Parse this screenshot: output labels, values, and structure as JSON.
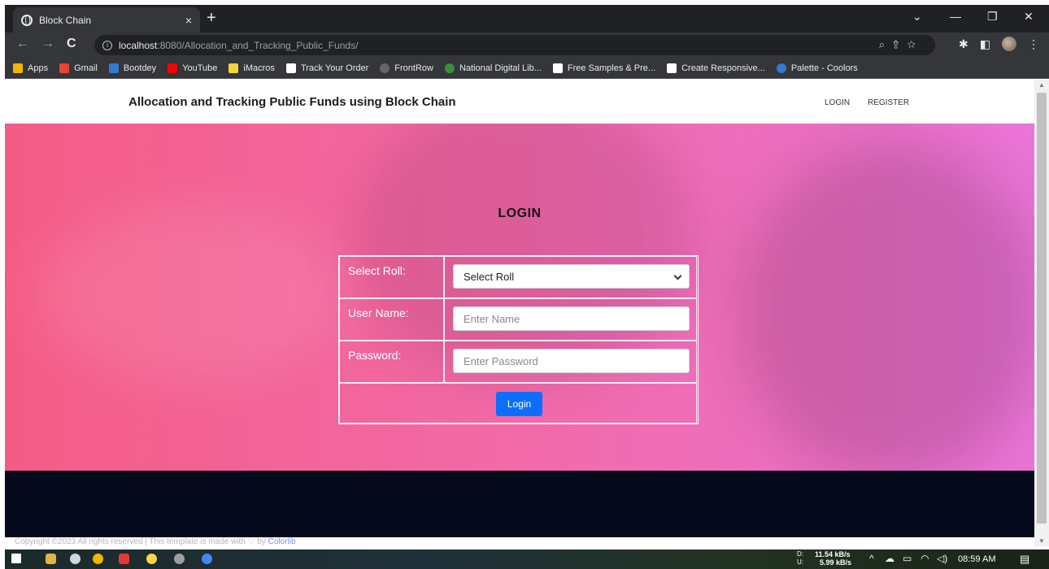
{
  "browser": {
    "tab_title": "Block Chain",
    "tab_close": "×",
    "new_tab": "+",
    "url_host": "localhost",
    "url_path": ":8080/Allocation_and_Tracking_Public_Funds/",
    "bookmarks": [
      {
        "label": "Apps",
        "color": "#f4b400"
      },
      {
        "label": "Gmail",
        "color": "#ea4335"
      },
      {
        "label": "Bootdey",
        "color": "#2f7bd6"
      },
      {
        "label": "YouTube",
        "color": "#ff0000"
      },
      {
        "label": "iMacros",
        "color": "#f5d33b"
      },
      {
        "label": "Track Your Order",
        "color": "#ffffff"
      },
      {
        "label": "FrontRow",
        "color": "#555555"
      },
      {
        "label": "National Digital Lib...",
        "color": "#3a8f3a"
      },
      {
        "label": "Free Samples & Pre...",
        "color": "#ffffff"
      },
      {
        "label": "Create Responsive...",
        "color": "#ffffff"
      },
      {
        "label": "Palette - Coolors",
        "color": "#2f7bd6"
      }
    ]
  },
  "site": {
    "brand": "Allocation and Tracking Public Funds using Block Chain",
    "nav": {
      "login": "LOGIN",
      "register": "REGISTER"
    }
  },
  "login": {
    "title": "LOGIN",
    "role_label": "Select Roll:",
    "role_value": "Select Roll",
    "username_label": "User Name:",
    "username_placeholder": "Enter Name",
    "password_label": "Password:",
    "password_placeholder": "Enter Password",
    "submit_label": "Login"
  },
  "footer": {
    "copyright_prefix": "Copyright ©2023 All rights reserved | This template is made with ♡ by ",
    "copyright_link": "Colorlib"
  },
  "taskbar": {
    "net_up": "11.54 kB/s",
    "net_down": "5.99 kB/s",
    "drive_d": "D:",
    "drive_u": "U:",
    "time": "08:59 AM"
  },
  "colors": {
    "hero_start": "#f45c86",
    "hero_end": "#ea74d8",
    "button": "#0d6efd",
    "footer": "#050a1b"
  }
}
